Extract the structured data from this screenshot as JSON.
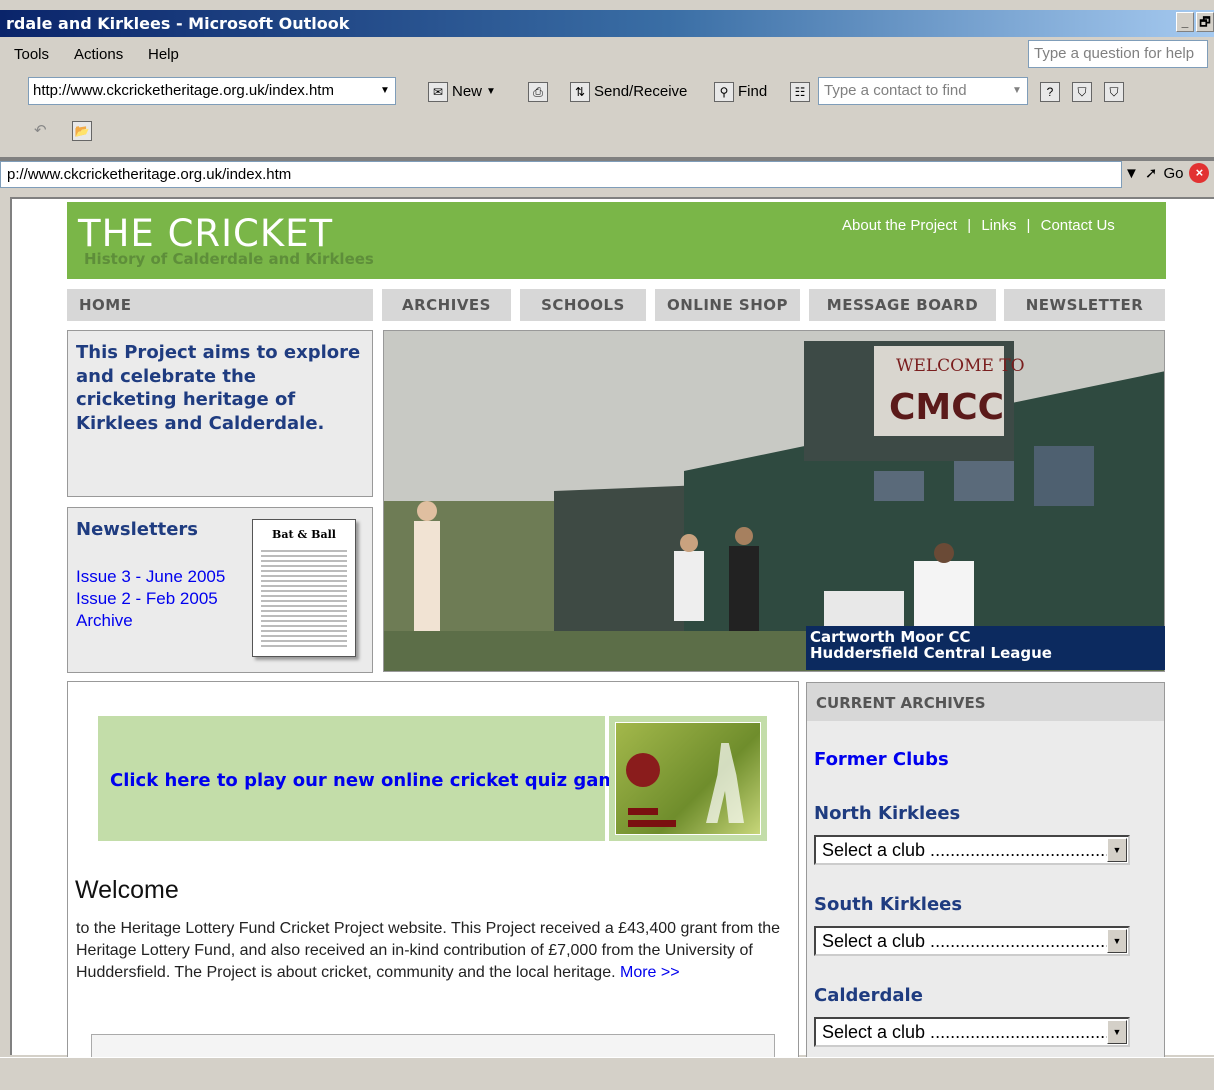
{
  "window": {
    "title": "rdale and Kirklees - Microsoft Outlook",
    "min": "_",
    "restore": "🗗"
  },
  "menu": {
    "items": [
      "Tools",
      "Actions",
      "Help"
    ],
    "help_placeholder": "Type a question for help"
  },
  "toolbar": {
    "url": "http://www.ckcricketheritage.org.uk/index.htm",
    "new_label": "New",
    "sendreceive_label": "Send/Receive",
    "find_label": "Find",
    "contact_placeholder": "Type a contact to find"
  },
  "address": {
    "url": "p://www.ckcricketheritage.org.uk/index.htm",
    "go_label": "Go"
  },
  "site": {
    "title": "THE CRICKET",
    "subtitle": "History of Calderdale and Kirklees",
    "toplinks": [
      "About the Project",
      "|",
      "Links",
      "|",
      "Contact Us"
    ],
    "nav": [
      "HOME",
      "ARCHIVES",
      "SCHOOLS",
      "ONLINE SHOP",
      "MESSAGE BOARD",
      "NEWSLETTER"
    ],
    "intro": "This Project aims to explore and celebrate the cricketing heritage of Kirklees and Calderdale.",
    "newsletters": {
      "title": "Newsletters",
      "links": [
        "Issue 3 - June 2005",
        "Issue 2 - Feb 2005",
        "Archive"
      ],
      "masthead": "Bat & Ball"
    },
    "photo": {
      "sign_line1": "WELCOME TO",
      "sign_line2": "CMCC",
      "caption_line1": "Cartworth Moor CC",
      "caption_line2": "Huddersfield Central League"
    },
    "quiz": {
      "link": "Click here to play our new online cricket quiz game"
    },
    "welcome": {
      "title": "Welcome",
      "text": "to the Heritage Lottery Fund Cricket Project website. This Project received a £43,400 grant from the Heritage Lottery Fund, and also received an in-kind contribution of £7,000 from the University of Huddersfield. The Project is about cricket, community and the local heritage.",
      "more": "More >>"
    },
    "archives": {
      "heading": "CURRENT ARCHIVES",
      "former": "Former Clubs",
      "sections": [
        "North Kirklees",
        "South Kirklees",
        "Calderdale"
      ],
      "select_value": "Select a club ......................................"
    }
  }
}
